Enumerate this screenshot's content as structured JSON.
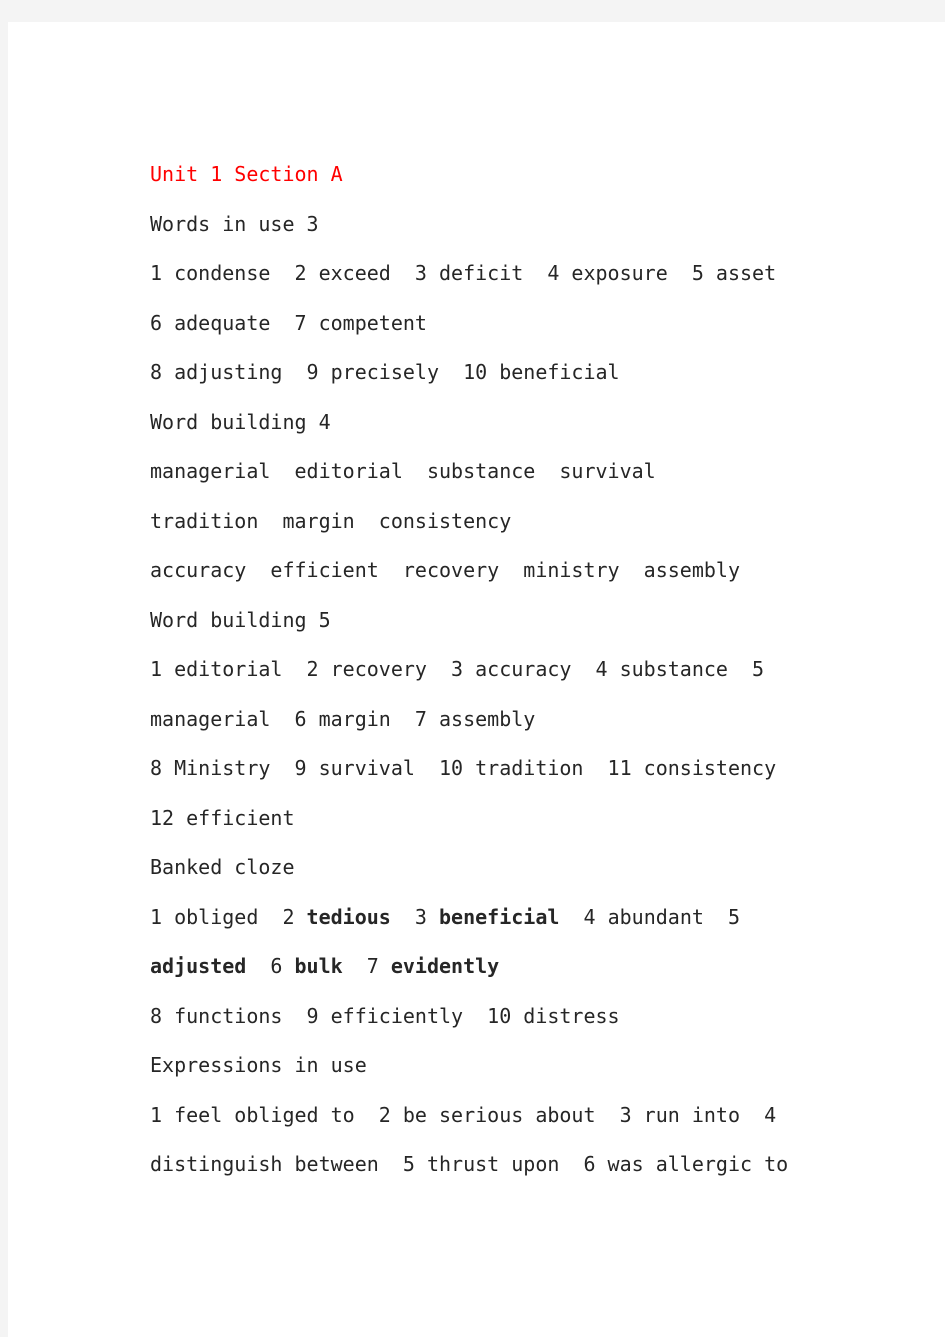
{
  "page": {
    "background_color": "#f4f4f4",
    "sheet_color": "#ffffff",
    "text_color": "#262626",
    "accent_color": "#ff0000"
  },
  "document": {
    "title": "Unit 1 Section A",
    "lines": [
      {
        "id": "heading-unit",
        "style": "heading-red",
        "segments": [
          {
            "text": "Unit 1 Section A",
            "bold": false
          }
        ]
      },
      {
        "id": "heading-words-in-use",
        "style": "body",
        "segments": [
          {
            "text": "Words in use 3",
            "bold": false
          }
        ]
      },
      {
        "id": "words-in-use-answers-1",
        "style": "body",
        "segments": [
          {
            "text": "1 condense  2 exceed  3 deficit  4 exposure  5 asset",
            "bold": false
          }
        ]
      },
      {
        "id": "words-in-use-answers-2",
        "style": "body",
        "segments": [
          {
            "text": "6 adequate  7 competent",
            "bold": false
          }
        ]
      },
      {
        "id": "words-in-use-answers-3",
        "style": "body",
        "segments": [
          {
            "text": "8 adjusting  9 precisely  10 beneficial",
            "bold": false
          }
        ]
      },
      {
        "id": "heading-word-building-4",
        "style": "body",
        "segments": [
          {
            "text": "Word building 4",
            "bold": false
          }
        ]
      },
      {
        "id": "word-building-4-row-1",
        "style": "body",
        "segments": [
          {
            "text": "managerial  editorial  substance  survival",
            "bold": false
          }
        ]
      },
      {
        "id": "word-building-4-row-2",
        "style": "body",
        "segments": [
          {
            "text": "tradition  margin  consistency",
            "bold": false
          }
        ]
      },
      {
        "id": "word-building-4-row-3",
        "style": "body",
        "segments": [
          {
            "text": "accuracy  efficient  recovery  ministry  assembly",
            "bold": false
          }
        ]
      },
      {
        "id": "heading-word-building-5",
        "style": "body",
        "segments": [
          {
            "text": "Word building 5",
            "bold": false
          }
        ]
      },
      {
        "id": "word-building-5-answers-1",
        "style": "body",
        "segments": [
          {
            "text": "1 editorial  2 recovery  3 accuracy  4 substance  5",
            "bold": false
          }
        ]
      },
      {
        "id": "word-building-5-answers-2",
        "style": "body",
        "segments": [
          {
            "text": "managerial  6 margin  7 assembly",
            "bold": false
          }
        ]
      },
      {
        "id": "word-building-5-answers-3",
        "style": "body",
        "segments": [
          {
            "text": "8 Ministry  9 survival  10 tradition  11 consistency",
            "bold": false
          }
        ]
      },
      {
        "id": "word-building-5-answers-4",
        "style": "body",
        "segments": [
          {
            "text": "12 efficient",
            "bold": false
          }
        ]
      },
      {
        "id": "heading-banked-cloze",
        "style": "body",
        "segments": [
          {
            "text": "Banked cloze",
            "bold": false
          }
        ]
      },
      {
        "id": "banked-cloze-answers-1",
        "style": "body",
        "segments": [
          {
            "text": "1 obliged  2 ",
            "bold": false
          },
          {
            "text": "tedious",
            "bold": true
          },
          {
            "text": "  3 ",
            "bold": false
          },
          {
            "text": "beneficial",
            "bold": true
          },
          {
            "text": "  4 abundant  5",
            "bold": false
          }
        ]
      },
      {
        "id": "banked-cloze-answers-2",
        "style": "body",
        "segments": [
          {
            "text": "adjusted",
            "bold": true
          },
          {
            "text": "  6 ",
            "bold": false
          },
          {
            "text": "bulk",
            "bold": true
          },
          {
            "text": "  7 ",
            "bold": false
          },
          {
            "text": "evidently",
            "bold": true
          }
        ]
      },
      {
        "id": "banked-cloze-answers-3",
        "style": "body",
        "segments": [
          {
            "text": "8 functions  9 efficiently  10 distress",
            "bold": false
          }
        ]
      },
      {
        "id": "heading-expressions-in-use",
        "style": "body",
        "segments": [
          {
            "text": "Expressions in use",
            "bold": false
          }
        ]
      },
      {
        "id": "expressions-in-use-answers-1",
        "style": "body",
        "segments": [
          {
            "text": "1 feel obliged to  2 be serious about  3 run into  4",
            "bold": false
          }
        ]
      },
      {
        "id": "expressions-in-use-answers-2",
        "style": "body",
        "segments": [
          {
            "text": "distinguish between  5 thrust upon  6 was allergic to",
            "bold": false
          }
        ]
      }
    ]
  }
}
